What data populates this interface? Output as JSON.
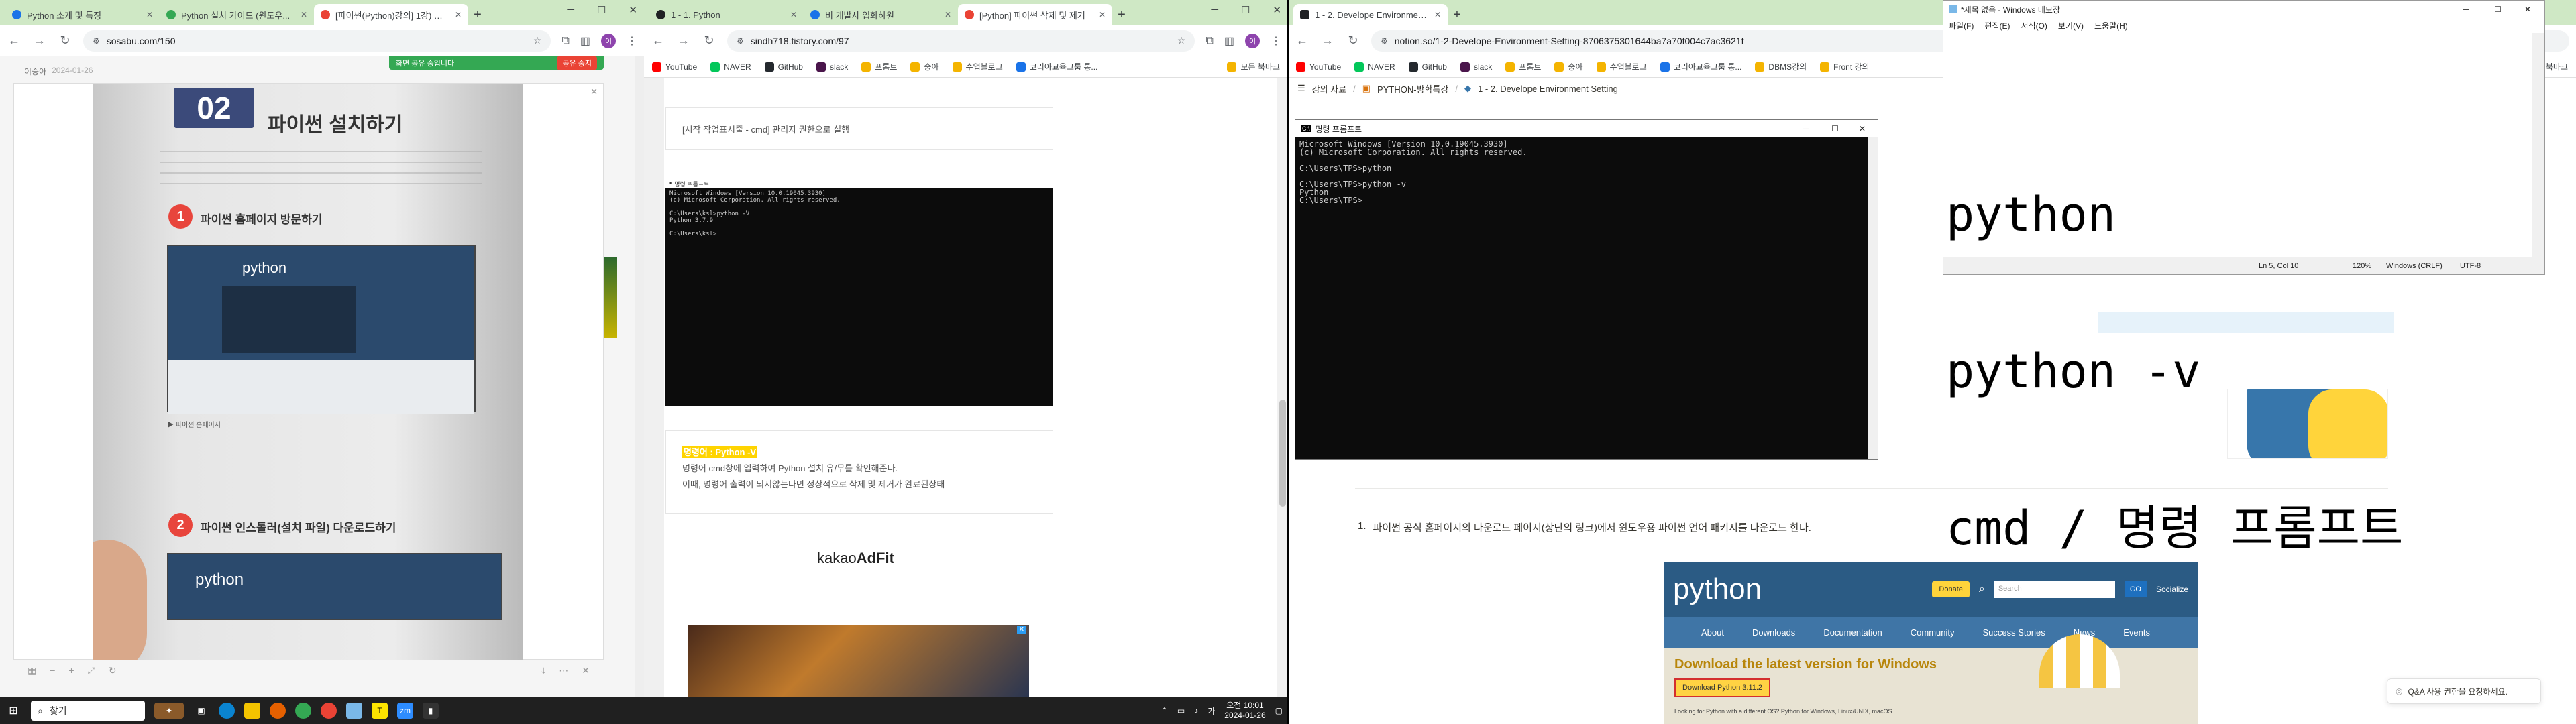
{
  "win1": {
    "tabs": [
      {
        "label": "Python 소개 및 특징",
        "color": "#1a73e8"
      },
      {
        "label": "Python 설치 가이드 (윈도우...",
        "color": "#34a853"
      },
      {
        "label": "[파이썬(Python)강의] 1강) 파이...",
        "color": "#ea4335"
      }
    ],
    "url": "sosabu.com/150",
    "author": "이승아",
    "date": "2024-01-26",
    "share_label": "화면 공유 중입니다",
    "stop_label": "공유 중지",
    "photo": {
      "badge": "02",
      "title": "파이썬 설치하기",
      "step1": "파이썬 홈페이지 방문하기",
      "step1_num": "1",
      "step2": "파이썬 인스톨러(설치 파일) 다운로드하기",
      "step2_num": "2",
      "site": "python",
      "caption1": "▶ 파이썬 홈페이지"
    }
  },
  "win2": {
    "tabs": [
      {
        "label": "1 - 1. Python",
        "color": "#202124"
      },
      {
        "label": "비 개발사 입화하원",
        "color": "#1a73e8"
      },
      {
        "label": "[Python] 파이썬 삭제 및 제거",
        "color": "#ea4335"
      }
    ],
    "url": "sindh718.tistory.com/97",
    "note_box": "[시작 작업표시줄 - cmd] 관리자 권한으로 실행",
    "cmd_title": "명령 프롬프트",
    "cmd_lines": "Microsoft Windows [Version 10.0.19045.3930]\n(c) Microsoft Corporation. All rights reserved.\n\nC:\\Users\\ksl>python -V\nPython 3.7.9\n\nC:\\Users\\ksl>",
    "highlight": "명령어 : Python -V",
    "desc1": "명령어 cmd창에 입력하여 Python 설치 유/무를 확인해준다.",
    "desc2": "이때, 명령어 출력이 되지않는다면 정상적으로 삭제 및 제거가 완료된상태",
    "ad_brand_a": "kakao",
    "ad_brand_b": "AdFit"
  },
  "win3": {
    "tabs": [
      {
        "label": "1 - 2. Develope Environment S...",
        "color": "#202124"
      }
    ],
    "url": "notion.so/1-2-Develope-Environment-Setting-8706375301644ba7a70f004c7ac3621f",
    "bookmarks": [
      {
        "label": "YouTube",
        "color": "#ff0000"
      },
      {
        "label": "NAVER",
        "color": "#03c75a"
      },
      {
        "label": "GitHub",
        "color": "#24292e"
      },
      {
        "label": "slack",
        "color": "#4a154b"
      },
      {
        "label": "프롬트",
        "color": "#f4b400"
      },
      {
        "label": "숭아",
        "color": "#f4b400"
      },
      {
        "label": "수업블로그",
        "color": "#f4b400"
      },
      {
        "label": "코리아교육그룹 통...",
        "color": "#1a73e8"
      },
      {
        "label": "DBMS강의",
        "color": "#f4b400"
      },
      {
        "label": "Front 강의",
        "color": "#f4b400"
      }
    ],
    "bookmarks_more": "모든 북마크",
    "breadcrumb": [
      "강의 자료",
      "PYTHON-방학특강",
      "1 - 2. Develope Environment Setting"
    ],
    "step_text": "파이썬 공식 홈페이지의 다운로드 페이지(상단의 링크)에서 윈도우용 파이썬 언어 패키지를 다운로드 한다.",
    "step_num": "1.",
    "pysite": {
      "logo": "python",
      "donate": "Donate",
      "search_ph": "Search",
      "go": "GO",
      "socialize": "Socialize",
      "nav": [
        "About",
        "Downloads",
        "Documentation",
        "Community",
        "Success Stories",
        "News",
        "Events"
      ],
      "headline": "Download the latest version for Windows",
      "btn": "Download Python 3.11.2",
      "foot": "Looking for Python with a different OS? Python for Windows, Linux/UNIX, macOS"
    },
    "qa": "Q&A 사용 권한을 요청하세요."
  },
  "cmd": {
    "title": "명령 프롬프트",
    "lines": "Microsoft Windows [Version 10.0.19045.3930]\n(c) Microsoft Corporation. All rights reserved.\n\nC:\\Users\\TPS>python\n\nC:\\Users\\TPS>python -v\nPython\nC:\\Users\\TPS>"
  },
  "notepad": {
    "title": "*제목 없음 - Windows 메모장",
    "menu": [
      "파일(F)",
      "편집(E)",
      "서식(O)",
      "보기(V)",
      "도움말(H)"
    ],
    "line1": "python",
    "line2": "python -v",
    "line3": "cmd / 명령 프롬프트",
    "status_pos": "Ln 5, Col 10",
    "status_zoom": "120%",
    "status_eol": "Windows (CRLF)",
    "status_enc": "UTF-8"
  },
  "win1_bookmarks": [
    {
      "label": "YouTube",
      "color": "#ff0000"
    },
    {
      "label": "NAVER",
      "color": "#03c75a"
    },
    {
      "label": "GitHub",
      "color": "#24292e"
    },
    {
      "label": "slack",
      "color": "#4a154b"
    },
    {
      "label": "프롬트",
      "color": "#f4b400"
    },
    {
      "label": "숭아",
      "color": "#f4b400"
    },
    {
      "label": "수업블로그",
      "color": "#f4b400"
    },
    {
      "label": "코리아교육그룹 통...",
      "color": "#1a73e8"
    }
  ],
  "win2_bookmarks_more": "모든 북마크",
  "taskbar": {
    "search": "찾기",
    "time": "오전 10:01",
    "date": "2024-01-26"
  }
}
